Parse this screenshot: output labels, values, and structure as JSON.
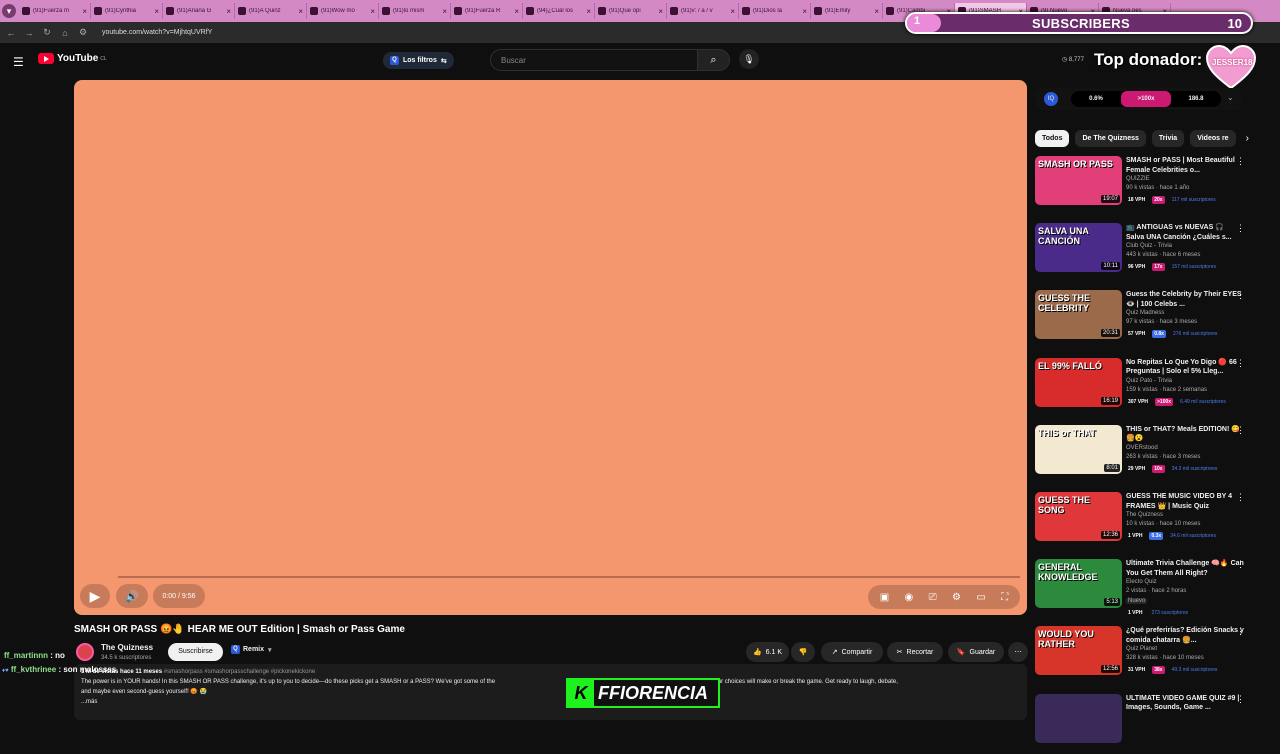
{
  "browser": {
    "tabs": [
      "(91)Fuerza m",
      "(91)Cynthia",
      "(91)Ariana G",
      "(91)A Quinz",
      "(91)Wow mo",
      "(91)lo mism",
      "(91)Fuerza R",
      "(94)¿Cuál los",
      "(91)Que opi",
      "(91)v: / a / v",
      "(91)Dios la ",
      "(91)Emily",
      "(91)Cambi",
      "(91)SMASH",
      "(9) Nuevo",
      "Nueva pes"
    ],
    "url": "youtube.com/watch?v=MjhtqUVRfY"
  },
  "youtube": {
    "logo": "YouTube",
    "logo_region": "CL",
    "filters_label": "Los filtros",
    "search_placeholder": "Buscar",
    "header_count": "8,777"
  },
  "overlay": {
    "subs_current": "1",
    "subs_label": "SUBSCRIBERS",
    "subs_goal": "10",
    "top_donor_label": "Top donador:",
    "top_donor_name": "JESSER18",
    "banner_text": "FFIORENCIA"
  },
  "player": {
    "time": "0:00 / 9:56",
    "color": "#f5976e"
  },
  "video": {
    "title": "SMASH OR PASS 😡🤚 HEAR ME OUT Edition | Smash or Pass Game",
    "channel": "The Quizness",
    "channel_subs": "34.5 k suscriptores",
    "subscribe_label": "Suscribirse",
    "remix_label": "Remix",
    "likes": "6.1 K",
    "share_label": "Compartir",
    "clip_label": "Recortar",
    "save_label": "Guardar",
    "views": "1 M de vistas",
    "age": "hace 11 meses",
    "tags": "#smashorpass #smashorpasschallenge #pickonekickone",
    "description_1": "The power is in YOUR hands! In this SMASH OR PASS challenge, it's up to you to decide—do these picks get a SMASH or a PASS? We've got some of the",
    "description_1b": "moments lined up, and your choices will make or break the game. Get ready to laugh, debate,",
    "description_2": "and maybe even second-guess yourself! 😡 😭",
    "more_label": "...más"
  },
  "chat": [
    {
      "user": "ff_martinnn",
      "text": ": no"
    },
    {
      "user": "ff_kvthrinee",
      "text": ": son malossss"
    }
  ],
  "extension": {
    "left": "0.6%",
    "mid": ">100x",
    "right": "186.8",
    "logo": "IQ"
  },
  "chips": [
    "Todos",
    "De The Quizness",
    "Trivia",
    "Videos re"
  ],
  "recommendations": [
    {
      "title": "SMASH or PASS | Most Beautiful Female Celebrities o...",
      "channel": "QUIZZIE",
      "meta": "90 k vistas · hace 1 año",
      "duration": "19:07",
      "vph": "18 VPH",
      "mult": "20x",
      "subs": "117 mil suscriptores",
      "thumb_text": "SMASH OR PASS",
      "thumb_color": "#e23f7a"
    },
    {
      "title": "📺 ANTIGUAS vs NUEVAS 🎧 Salva UNA Canción ¿Cuáles s...",
      "channel": "Club Quiz - Trivia",
      "meta": "443 k vistas · hace 6 meses",
      "duration": "10:11",
      "vph": "96 VPH",
      "mult": "17x",
      "subs": "157 mil suscriptores",
      "thumb_text": "SALVA UNA CANCIÓN",
      "thumb_color": "#4a2b8a"
    },
    {
      "title": "Guess the Celebrity by Their EYES 👁️ | 100 Celebs ...",
      "channel": "Quiz Madness",
      "meta": "97 k vistas · hace 3 meses",
      "duration": "20:31",
      "vph": "57 VPH",
      "mult": "0.8x",
      "subs": "276 mil suscriptores",
      "thumb_text": "GUESS THE CELEBRITY",
      "thumb_color": "#9a6a4a"
    },
    {
      "title": "No Repitas Lo Que Yo Digo 🔴 66 Preguntas | Solo el 5% Lleg...",
      "channel": "Quiz Pato - Trivia",
      "meta": "159 k vistas · hace 2 semanas",
      "duration": "16:19",
      "vph": "307 VPH",
      "mult": ">100x",
      "subs": "6.49 mil suscriptores",
      "thumb_text": "EL 99% FALLÓ",
      "thumb_color": "#d82b2b"
    },
    {
      "title": "THIS or THAT? Meals EDITION! 😋🍔😮",
      "channel": "OVERstood",
      "meta": "263 k vistas · hace 3 meses",
      "duration": "8:01",
      "vph": "29 VPH",
      "mult": "10x",
      "subs": "34.3 mil suscriptores",
      "thumb_text": "THIS or THAT",
      "thumb_color": "#f3e8d0"
    },
    {
      "title": "GUESS THE MUSIC VIDEO BY 4 FRAMES 👑 | Music Quiz",
      "channel": "The Quizness",
      "meta": "10 k vistas · hace 10 meses",
      "duration": "12:36",
      "vph": "1 VPH",
      "mult": "0.3x",
      "subs": "34.6 mil suscriptores",
      "thumb_text": "GUESS THE SONG",
      "thumb_color": "#e0383a"
    },
    {
      "title": "Ultimate Trivia Challenge 🧠🔥 Can You Get Them All Right?",
      "channel": "Electo Quiz",
      "meta": "2 vistas · hace 2 horas",
      "duration": "5:13",
      "vph": "1 VPH",
      "mult": "",
      "subs": "273 suscriptores",
      "badge": "Nuevo",
      "thumb_text": "GENERAL KNOWLEDGE",
      "thumb_color": "#2c8a3c"
    },
    {
      "title": "¿Qué preferirías? Edición Snacks y comida chatarra 🍔...",
      "channel": "Quiz Planet",
      "meta": "328 k vistas · hace 10 meses",
      "duration": "12:56",
      "vph": "31 VPH",
      "mult": "38x",
      "subs": "49.3 mil suscriptores",
      "thumb_text": "WOULD YOU RATHER",
      "thumb_color": "#d8352a"
    },
    {
      "title": "ULTIMATE VIDEO GAME QUIZ #9 | Images, Sounds, Game ...",
      "channel": "",
      "meta": "",
      "duration": "",
      "vph": "",
      "mult": "",
      "subs": "",
      "thumb_text": "",
      "thumb_color": "#3a2a5a"
    }
  ]
}
